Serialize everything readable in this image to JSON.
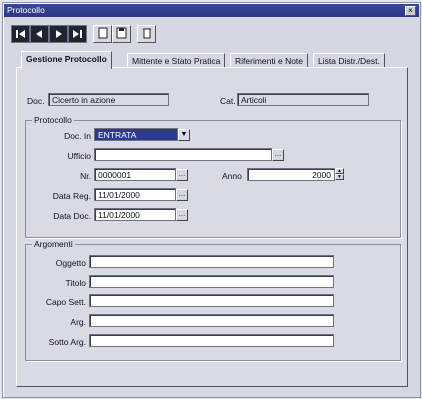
{
  "window": {
    "title": "Protocollo",
    "close_glyph": "×"
  },
  "toolbar": {
    "first_icon": "first-record-icon",
    "prev_icon": "previous-record-icon",
    "next_icon": "next-record-icon",
    "last_icon": "last-record-icon",
    "new_icon": "new-document-icon",
    "save_icon": "save-icon",
    "delete_icon": "delete-icon"
  },
  "tabs": [
    {
      "label": "Gestione Protocollo"
    },
    {
      "label": "Mittente e Stato Pratica"
    },
    {
      "label": "Riferimenti e Note"
    },
    {
      "label": "Lista Distr./Dest."
    }
  ],
  "header": {
    "doc_label": "Doc.",
    "doc_value": "Cicerto in azione",
    "cat_label": "Cat.",
    "cat_value": "Articoli"
  },
  "protocollo": {
    "group_title": "Protocollo",
    "doc_in_label": "Doc. In",
    "doc_in_value": "ENTRATA",
    "ufficio_label": "Ufficio",
    "ufficio_value": "",
    "nr_label": "Nr.",
    "nr_value": "0000001",
    "anno_label": "Anno",
    "anno_value": "2000",
    "data_reg_label": "Data Reg.",
    "data_reg_value": "11/01/2000",
    "data_doc_label": "Data Doc.",
    "data_doc_value": "11/01/2000"
  },
  "argomenti": {
    "group_title": "Argomenti",
    "oggetto_label": "Oggetto",
    "titolo_label": "Titolo",
    "capo_sett_label": "Capo Sett.",
    "arg_label": "Arg.",
    "sotto_arg_label": "Sotto Arg."
  },
  "colors": {
    "title_bar": "#2a3782",
    "selection": "#2c3a8e",
    "panel": "#d5d8e2"
  }
}
